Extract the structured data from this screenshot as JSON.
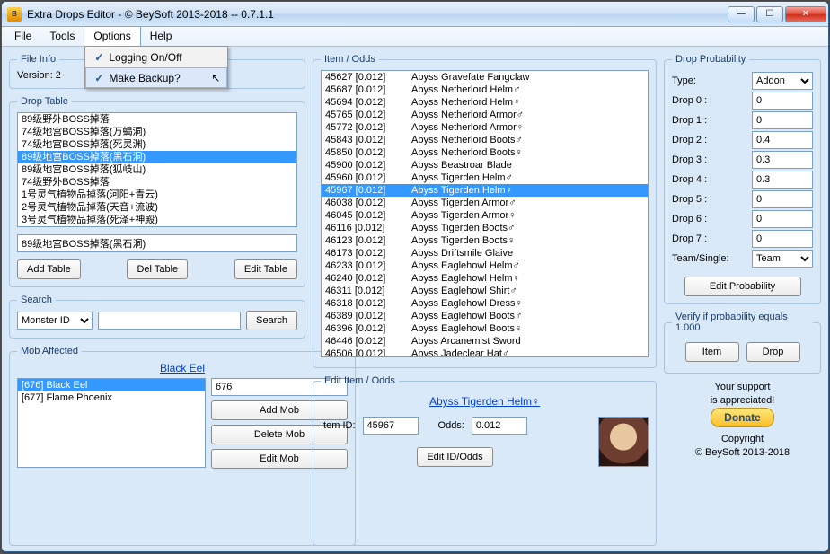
{
  "title": "Extra Drops Editor - © BeySoft  2013-2018  --  0.7.1.1",
  "icon_label": "Bey SW",
  "menu": {
    "file": "File",
    "tools": "Tools",
    "options": "Options",
    "help": "Help"
  },
  "options_menu": {
    "logging": "Logging On/Off",
    "backup": "Make Backup?"
  },
  "fileinfo": {
    "legend": "File Info",
    "version_label": "Version: 2"
  },
  "droptable": {
    "legend": "Drop Table",
    "items": [
      "89级野外BOSS掉落",
      "74级地宫BOSS掉落(万蝎洞)",
      "74级地宫BOSS掉落(死灵渊)",
      "89级地宫BOSS掉落(黑石洞)",
      "89级地宫BOSS掉落(狐岐山)",
      "74级野外BOSS掉落",
      "1号灵气植物品掉落(河阳+青云)",
      "2号灵气植物品掉落(天音+流波)",
      "3号灵气植物品掉落(死泽+神殿)"
    ],
    "selected_index": 3,
    "input": "89级地宫BOSS掉落(黑石洞)",
    "add": "Add Table",
    "del": "Del Table",
    "edit": "Edit Table"
  },
  "search": {
    "legend": "Search",
    "type": "Monster ID",
    "btn": "Search"
  },
  "mob": {
    "legend": "Mob Affected",
    "link": "Black Eel",
    "items": [
      "[676] Black Eel",
      "[677] Flame Phoenix"
    ],
    "selected_index": 0,
    "id": "676",
    "add": "Add Mob",
    "del": "Delete Mob",
    "edit": "Edit Mob"
  },
  "itemodds": {
    "legend": "Item / Odds",
    "rows": [
      {
        "id": "45627",
        "odds": "[0.012]",
        "name": "Abyss Gravefate Fangclaw"
      },
      {
        "id": "45687",
        "odds": "[0.012]",
        "name": "Abyss Netherlord Helm♂"
      },
      {
        "id": "45694",
        "odds": "[0.012]",
        "name": "Abyss Netherlord Helm♀"
      },
      {
        "id": "45765",
        "odds": "[0.012]",
        "name": "Abyss Netherlord Armor♂"
      },
      {
        "id": "45772",
        "odds": "[0.012]",
        "name": "Abyss Netherlord Armor♀"
      },
      {
        "id": "45843",
        "odds": "[0.012]",
        "name": "Abyss Netherlord Boots♂"
      },
      {
        "id": "45850",
        "odds": "[0.012]",
        "name": "Abyss Netherlord Boots♀"
      },
      {
        "id": "45900",
        "odds": "[0.012]",
        "name": "Abyss Beastroar Blade"
      },
      {
        "id": "45960",
        "odds": "[0.012]",
        "name": "Abyss Tigerden Helm♂"
      },
      {
        "id": "45967",
        "odds": "[0.012]",
        "name": "Abyss Tigerden Helm♀"
      },
      {
        "id": "46038",
        "odds": "[0.012]",
        "name": "Abyss Tigerden Armor♂"
      },
      {
        "id": "46045",
        "odds": "[0.012]",
        "name": "Abyss Tigerden Armor♀"
      },
      {
        "id": "46116",
        "odds": "[0.012]",
        "name": "Abyss Tigerden Boots♂"
      },
      {
        "id": "46123",
        "odds": "[0.012]",
        "name": "Abyss Tigerden Boots♀"
      },
      {
        "id": "46173",
        "odds": "[0.012]",
        "name": "Abyss Driftsmile Glaive"
      },
      {
        "id": "46233",
        "odds": "[0.012]",
        "name": "Abyss Eaglehowl Helm♂"
      },
      {
        "id": "46240",
        "odds": "[0.012]",
        "name": "Abyss Eaglehowl Helm♀"
      },
      {
        "id": "46311",
        "odds": "[0.012]",
        "name": "Abyss Eaglehowl Shirt♂"
      },
      {
        "id": "46318",
        "odds": "[0.012]",
        "name": "Abyss Eaglehowl Dress♀"
      },
      {
        "id": "46389",
        "odds": "[0.012]",
        "name": "Abyss Eaglehowl Boots♂"
      },
      {
        "id": "46396",
        "odds": "[0.012]",
        "name": "Abyss Eaglehowl Boots♀"
      },
      {
        "id": "46446",
        "odds": "[0.012]",
        "name": "Abyss Arcanemist Sword"
      },
      {
        "id": "46506",
        "odds": "[0.012]",
        "name": "Abyss Jadeclear Hat♂"
      }
    ],
    "selected_index": 9
  },
  "edititem": {
    "legend": "Edit Item / Odds",
    "link": "Abyss Tigerden Helm♀",
    "id_label": "Item ID:",
    "id": "45967",
    "odds_label": "Odds:",
    "odds": "0.012",
    "btn": "Edit ID/Odds"
  },
  "prob": {
    "legend": "Drop Probability",
    "type_label": "Type:",
    "type": "Addon",
    "labels": [
      "Drop 0 :",
      "Drop 1 :",
      "Drop 2 :",
      "Drop 3 :",
      "Drop 4 :",
      "Drop 5 :",
      "Drop 6 :",
      "Drop 7 :"
    ],
    "values": [
      "0",
      "0",
      "0.4",
      "0.3",
      "0.3",
      "0",
      "0",
      "0"
    ],
    "team_label": "Team/Single:",
    "team": "Team",
    "edit": "Edit Probability"
  },
  "verify": {
    "legend": "Verify if probability equals 1.000",
    "item": "Item",
    "drop": "Drop"
  },
  "support": {
    "l1": "Your support",
    "l2": "is appreciated!",
    "donate": "Donate",
    "copy": "Copyright",
    "owner": "© BeySoft  2013-2018"
  }
}
